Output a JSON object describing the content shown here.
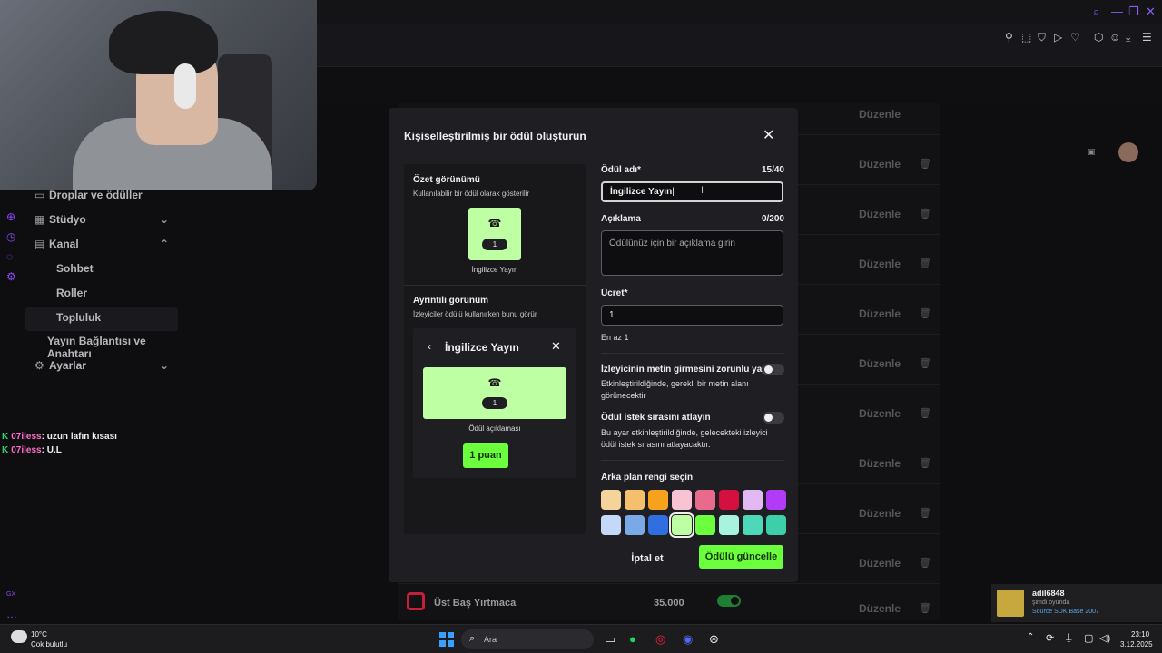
{
  "modal": {
    "title": "Kişiselleştirilmiş bir ödül oluşturun",
    "close_glyph": "✕",
    "summary": {
      "heading": "Özet görünümü",
      "subtext": "Kullanılabilir bir ödül olarak gösterilir",
      "cost_pill": "1",
      "caption": "İngilizce Yayın"
    },
    "detail": {
      "heading": "Ayrıntılı görünüm",
      "subtext": "İzleyiciler ödülü kullanırken bunu görür",
      "card_title": "İngilizce Yayın",
      "cost_pill": "1",
      "caption": "Ödül açıklaması",
      "points_button": "1 puan"
    },
    "form": {
      "name_label": "Ödül adı*",
      "name_count": "15/40",
      "name_value": "İngilizce Yayın",
      "description_label": "Açıklama",
      "description_count": "0/200",
      "description_placeholder": "Ödülünüz için bir açıklama girin",
      "cost_label": "Ücret*",
      "cost_value": "1",
      "cost_help": "En az 1",
      "require_text_label": "İzleyicinin metin girmesini zorunlu yap",
      "require_text_desc": "Etkinleştirildiğinde, gerekli bir metin alanı görünecektir",
      "require_text_enabled": false,
      "skip_queue_label": "Ödül istek sırasını atlayın",
      "skip_queue_desc": "Bu ayar etkinleştirildiğinde, gelecekteki izleyici ödül istek sırasını atlayacaktır.",
      "skip_queue_enabled": false,
      "bg_color_label": "Arka plan rengi seçin",
      "swatches": [
        "#f6d39b",
        "#f4c06d",
        "#f6a21c",
        "#f8c4d4",
        "#e86a8c",
        "#d3103e",
        "#e2b8f5",
        "#b13cf5",
        "#c3d9f7",
        "#7aa9e7",
        "#2f6fe0",
        "#bfffa4",
        "#6cff3d",
        "#a7f3dd",
        "#4dd8b9",
        "#3dcfa9"
      ],
      "selected_swatch": 11
    },
    "cancel_label": "İptal et",
    "save_label": "Ödülü güncelle"
  },
  "background": {
    "edit_label": "Düzenle",
    "last_row": {
      "name": "Üst Baş Yırtmaca",
      "cost": "35.000"
    }
  },
  "sidebar": {
    "items": [
      {
        "label": "Droplar ve ödüller"
      },
      {
        "label": "Stüdyo"
      },
      {
        "label": "Kanal"
      },
      {
        "label": "Sohbet"
      },
      {
        "label": "Roller"
      },
      {
        "label": "Topluluk"
      },
      {
        "label": "Yayın Bağlantısı ve Anahtarı"
      },
      {
        "label": "Ayarlar"
      }
    ]
  },
  "chat": [
    {
      "user": "07iless",
      "message": ": uzun lafın kısası"
    },
    {
      "user": "07iless",
      "message": ": U.L"
    }
  ],
  "notification": {
    "name": "adil6848",
    "status": "şimdi oyunda",
    "game": "Source SDK Base 2007"
  },
  "taskbar": {
    "temperature": "10°C",
    "weather": "Çok bulutlu",
    "search_placeholder": "Ara",
    "time": "23:10",
    "date": "3.12.2025"
  }
}
